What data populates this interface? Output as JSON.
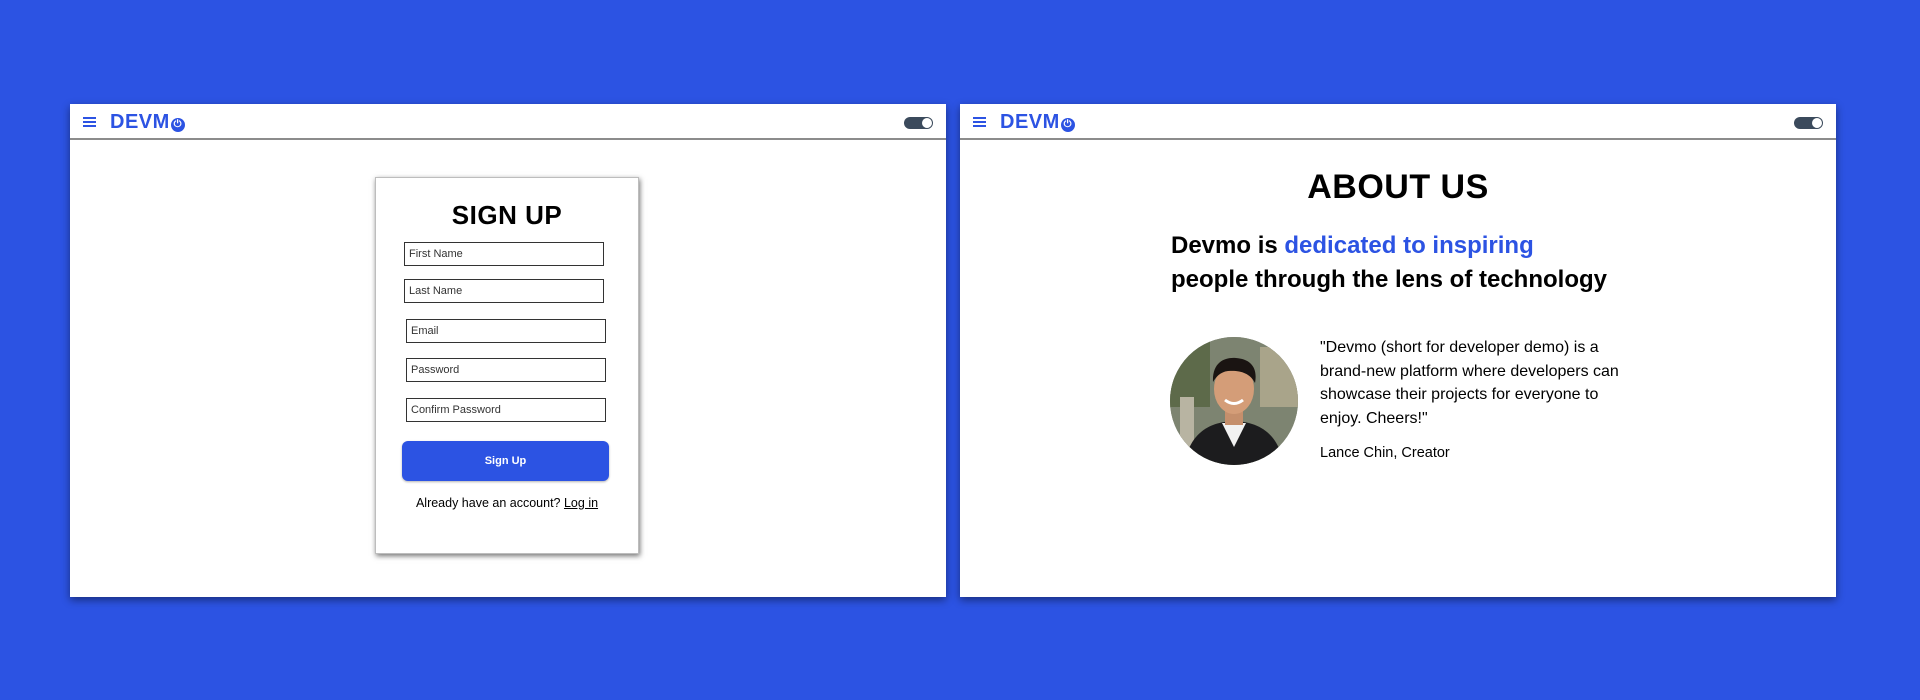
{
  "brand": {
    "logo_text": "DEVM",
    "accent_color": "#2c53e3",
    "background_color": "#2c53e3"
  },
  "navbar": {
    "menu_icon": "hamburger-menu-icon",
    "theme_toggle_state": "on"
  },
  "signup": {
    "title": "SIGN UP",
    "fields": {
      "first_name": "First Name",
      "last_name": "Last Name",
      "email": "Email",
      "password": "Password",
      "confirm_password": "Confirm Password"
    },
    "submit_label": "Sign Up",
    "login_prompt": "Already have an account?",
    "login_link": "Log in"
  },
  "about": {
    "title": "ABOUT US",
    "tagline_start": "Devmo is",
    "tagline_highlight": "dedicated to inspiring",
    "tagline_end": "people through the lens of technology",
    "quote": "\"Devmo (short for developer demo) is a brand-new platform where developers can showcase their projects for everyone to enjoy. Cheers!\"",
    "attribution": "Lance Chin, Creator"
  }
}
